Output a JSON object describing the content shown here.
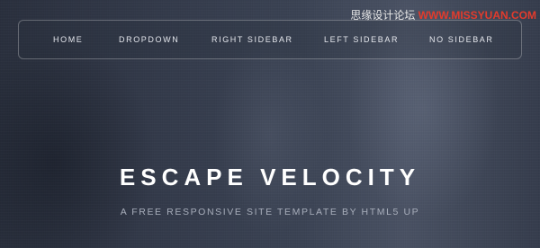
{
  "watermark": {
    "cn": "思缘设计论坛",
    "url": "WWW.MISSYUAN.COM"
  },
  "nav": {
    "items": [
      {
        "label": "HOME"
      },
      {
        "label": "DROPDOWN"
      },
      {
        "label": "RIGHT SIDEBAR"
      },
      {
        "label": "LEFT SIDEBAR"
      },
      {
        "label": "NO SIDEBAR"
      }
    ]
  },
  "hero": {
    "title": "ESCAPE VELOCITY",
    "subtitle": "A FREE RESPONSIVE SITE TEMPLATE BY HTML5 UP"
  },
  "colors": {
    "background": "#363d4d",
    "nav_text": "#e6e8ee",
    "title": "#ffffff",
    "subtitle": "#a8aebb",
    "watermark_accent": "#e33b2c"
  }
}
